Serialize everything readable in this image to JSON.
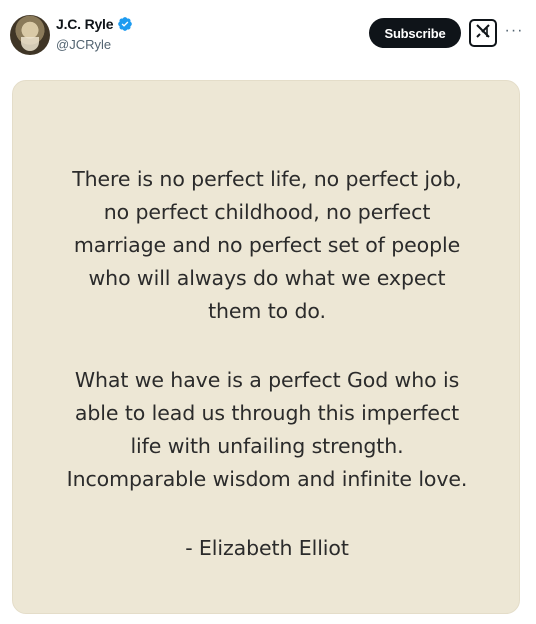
{
  "post": {
    "author_name": "J.C. Ryle",
    "author_handle": "@JCRyle",
    "verified_icon": "verified-badge-icon",
    "verified_color": "#1d9bf0",
    "subscribe_label": "Subscribe",
    "grok_icon": "grok-icon",
    "more_icon": "more-horizontal-icon",
    "more_label": "···"
  },
  "quote": {
    "background_color": "#ede7d5",
    "paragraph1": [
      "There is no perfect life, no perfect job,",
      "no perfect childhood, no perfect",
      "marriage and no perfect set of people",
      "who will always do what we expect",
      "them to do."
    ],
    "paragraph2": [
      "What we have is a perfect God who is",
      "able to lead us through this imperfect",
      "life with unfailing strength.",
      "Incomparable wisdom and infinite love."
    ],
    "attribution": "- Elizabeth Elliot"
  }
}
